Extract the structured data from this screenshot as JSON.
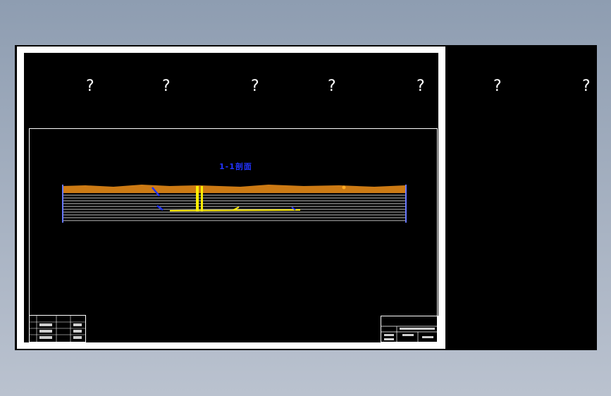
{
  "canvas": {
    "header_marks": [
      "?",
      "?",
      "?",
      "?",
      "?",
      "?",
      "?"
    ]
  },
  "drawing": {
    "section_label": "1-1剖面"
  },
  "colors": {
    "background_gradient": [
      "#8e9db1",
      "#bac2cf"
    ],
    "canvas": "#000000",
    "frame": "#ffffff",
    "label_blue": "#2233ff",
    "soil_orange": "#cc7a14",
    "highlight_yellow": "#ffee00",
    "line_white": "#ffffff"
  }
}
